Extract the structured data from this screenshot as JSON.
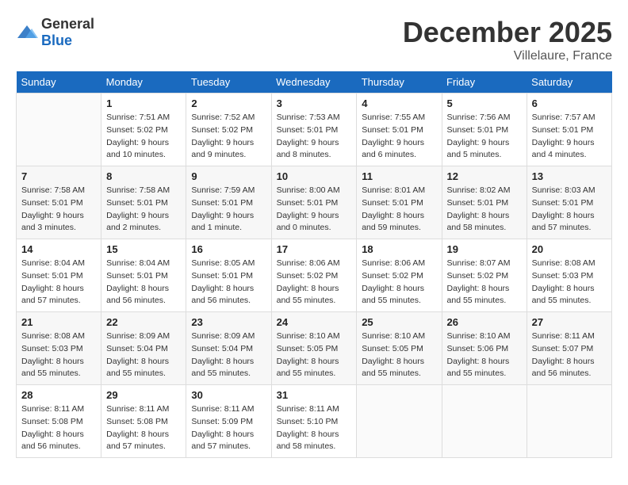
{
  "logo": {
    "text_general": "General",
    "text_blue": "Blue"
  },
  "title": "December 2025",
  "location": "Villelaure, France",
  "days_of_week": [
    "Sunday",
    "Monday",
    "Tuesday",
    "Wednesday",
    "Thursday",
    "Friday",
    "Saturday"
  ],
  "weeks": [
    [
      {
        "num": "",
        "info": ""
      },
      {
        "num": "1",
        "info": "Sunrise: 7:51 AM\nSunset: 5:02 PM\nDaylight: 9 hours\nand 10 minutes."
      },
      {
        "num": "2",
        "info": "Sunrise: 7:52 AM\nSunset: 5:02 PM\nDaylight: 9 hours\nand 9 minutes."
      },
      {
        "num": "3",
        "info": "Sunrise: 7:53 AM\nSunset: 5:01 PM\nDaylight: 9 hours\nand 8 minutes."
      },
      {
        "num": "4",
        "info": "Sunrise: 7:55 AM\nSunset: 5:01 PM\nDaylight: 9 hours\nand 6 minutes."
      },
      {
        "num": "5",
        "info": "Sunrise: 7:56 AM\nSunset: 5:01 PM\nDaylight: 9 hours\nand 5 minutes."
      },
      {
        "num": "6",
        "info": "Sunrise: 7:57 AM\nSunset: 5:01 PM\nDaylight: 9 hours\nand 4 minutes."
      }
    ],
    [
      {
        "num": "7",
        "info": "Sunrise: 7:58 AM\nSunset: 5:01 PM\nDaylight: 9 hours\nand 3 minutes."
      },
      {
        "num": "8",
        "info": "Sunrise: 7:58 AM\nSunset: 5:01 PM\nDaylight: 9 hours\nand 2 minutes."
      },
      {
        "num": "9",
        "info": "Sunrise: 7:59 AM\nSunset: 5:01 PM\nDaylight: 9 hours\nand 1 minute."
      },
      {
        "num": "10",
        "info": "Sunrise: 8:00 AM\nSunset: 5:01 PM\nDaylight: 9 hours\nand 0 minutes."
      },
      {
        "num": "11",
        "info": "Sunrise: 8:01 AM\nSunset: 5:01 PM\nDaylight: 8 hours\nand 59 minutes."
      },
      {
        "num": "12",
        "info": "Sunrise: 8:02 AM\nSunset: 5:01 PM\nDaylight: 8 hours\nand 58 minutes."
      },
      {
        "num": "13",
        "info": "Sunrise: 8:03 AM\nSunset: 5:01 PM\nDaylight: 8 hours\nand 57 minutes."
      }
    ],
    [
      {
        "num": "14",
        "info": "Sunrise: 8:04 AM\nSunset: 5:01 PM\nDaylight: 8 hours\nand 57 minutes."
      },
      {
        "num": "15",
        "info": "Sunrise: 8:04 AM\nSunset: 5:01 PM\nDaylight: 8 hours\nand 56 minutes."
      },
      {
        "num": "16",
        "info": "Sunrise: 8:05 AM\nSunset: 5:01 PM\nDaylight: 8 hours\nand 56 minutes."
      },
      {
        "num": "17",
        "info": "Sunrise: 8:06 AM\nSunset: 5:02 PM\nDaylight: 8 hours\nand 55 minutes."
      },
      {
        "num": "18",
        "info": "Sunrise: 8:06 AM\nSunset: 5:02 PM\nDaylight: 8 hours\nand 55 minutes."
      },
      {
        "num": "19",
        "info": "Sunrise: 8:07 AM\nSunset: 5:02 PM\nDaylight: 8 hours\nand 55 minutes."
      },
      {
        "num": "20",
        "info": "Sunrise: 8:08 AM\nSunset: 5:03 PM\nDaylight: 8 hours\nand 55 minutes."
      }
    ],
    [
      {
        "num": "21",
        "info": "Sunrise: 8:08 AM\nSunset: 5:03 PM\nDaylight: 8 hours\nand 55 minutes."
      },
      {
        "num": "22",
        "info": "Sunrise: 8:09 AM\nSunset: 5:04 PM\nDaylight: 8 hours\nand 55 minutes."
      },
      {
        "num": "23",
        "info": "Sunrise: 8:09 AM\nSunset: 5:04 PM\nDaylight: 8 hours\nand 55 minutes."
      },
      {
        "num": "24",
        "info": "Sunrise: 8:10 AM\nSunset: 5:05 PM\nDaylight: 8 hours\nand 55 minutes."
      },
      {
        "num": "25",
        "info": "Sunrise: 8:10 AM\nSunset: 5:05 PM\nDaylight: 8 hours\nand 55 minutes."
      },
      {
        "num": "26",
        "info": "Sunrise: 8:10 AM\nSunset: 5:06 PM\nDaylight: 8 hours\nand 55 minutes."
      },
      {
        "num": "27",
        "info": "Sunrise: 8:11 AM\nSunset: 5:07 PM\nDaylight: 8 hours\nand 56 minutes."
      }
    ],
    [
      {
        "num": "28",
        "info": "Sunrise: 8:11 AM\nSunset: 5:08 PM\nDaylight: 8 hours\nand 56 minutes."
      },
      {
        "num": "29",
        "info": "Sunrise: 8:11 AM\nSunset: 5:08 PM\nDaylight: 8 hours\nand 57 minutes."
      },
      {
        "num": "30",
        "info": "Sunrise: 8:11 AM\nSunset: 5:09 PM\nDaylight: 8 hours\nand 57 minutes."
      },
      {
        "num": "31",
        "info": "Sunrise: 8:11 AM\nSunset: 5:10 PM\nDaylight: 8 hours\nand 58 minutes."
      },
      {
        "num": "",
        "info": ""
      },
      {
        "num": "",
        "info": ""
      },
      {
        "num": "",
        "info": ""
      }
    ]
  ]
}
